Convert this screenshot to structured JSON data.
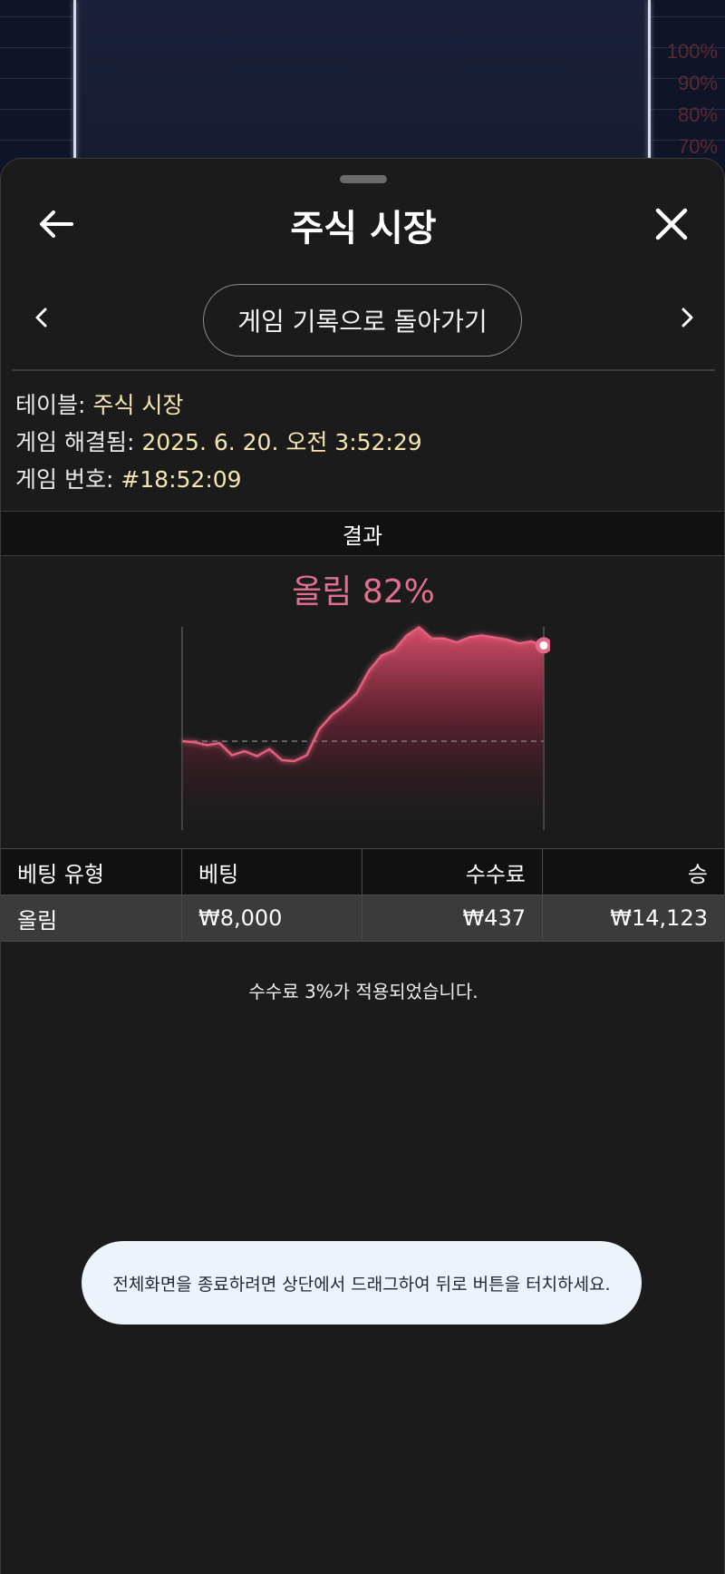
{
  "background": {
    "percent_labels": [
      "100%",
      "90%",
      "80%",
      "70%"
    ]
  },
  "header": {
    "title": "주식 시장",
    "back_icon": "arrow-left-icon",
    "close_icon": "close-icon"
  },
  "navigation": {
    "prev_icon": "chevron-left-icon",
    "next_icon": "chevron-right-icon",
    "history_button_label": "게임 기록으로 돌아가기"
  },
  "info": {
    "table_label": "테이블: ",
    "table_value": "주식 시장",
    "resolved_label": "게임 해결됨: ",
    "resolved_value": "2025. 6. 20. 오전 3:52:29",
    "game_number_label": "게임 번호: ",
    "game_number_value": "#18:52:09"
  },
  "result": {
    "section_label": "결과",
    "outcome_label": "올림 82%"
  },
  "chart_data": {
    "type": "area",
    "y": [
      0.0,
      -0.1,
      -0.4,
      -0.2,
      -1.4,
      -1.0,
      -1.5,
      -0.8,
      -1.9,
      -2.0,
      -1.4,
      1.2,
      2.6,
      3.6,
      4.8,
      7.1,
      8.6,
      9.1,
      10.6,
      11.4,
      10.3,
      10.3,
      9.9,
      10.4,
      10.6,
      10.4,
      10.2,
      9.8,
      10.0,
      9.6
    ],
    "baseline": 0,
    "colors": {
      "fill_top": "#e0506e",
      "fill_bottom": "#1b1b1b",
      "line": "#e2607c",
      "marker": "#e26a8a"
    }
  },
  "bet_table": {
    "headers": [
      "베팅 유형",
      "베팅",
      "수수료",
      "승"
    ],
    "rows": [
      [
        "올림",
        "₩8,000",
        "₩437",
        "₩14,123"
      ]
    ]
  },
  "fee_note": "수수료 3%가 적용되었습니다.",
  "toast": "전체화면을 종료하려면 상단에서 드래그하여 뒤로 버튼을 터치하세요."
}
